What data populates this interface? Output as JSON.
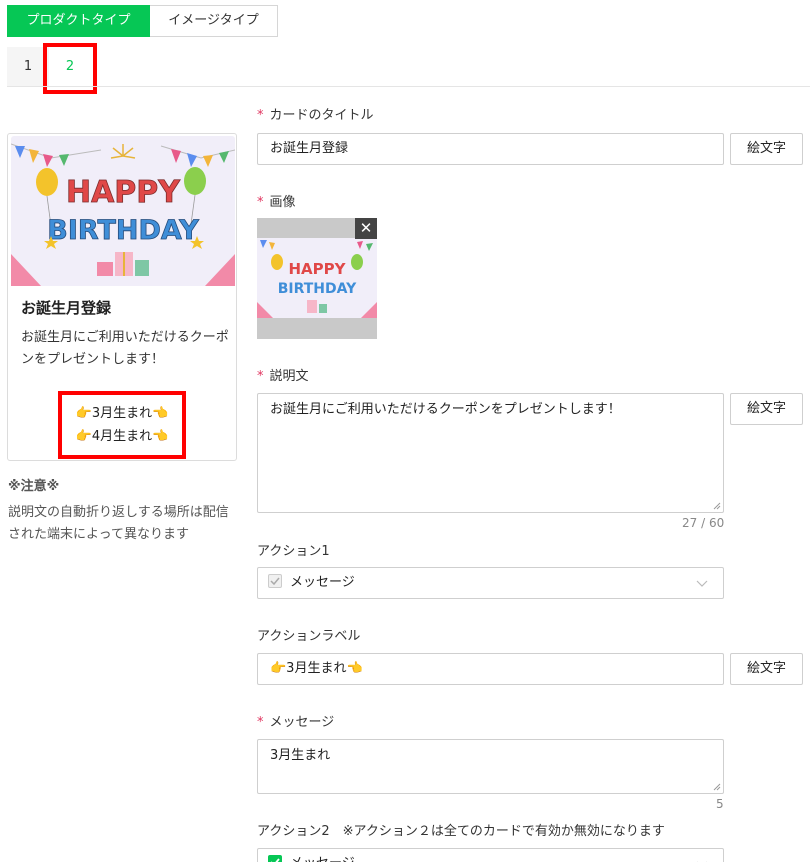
{
  "type_tabs": [
    "プロダクトタイプ",
    "イメージタイプ"
  ],
  "page_tabs": [
    "1",
    "2"
  ],
  "preview": {
    "title": "お誕生月登録",
    "description": "お誕生月にご利用いただけるクーポンをプレゼントします！",
    "actions": [
      "👉3月生まれ👈",
      "👉4月生まれ👈"
    ],
    "image_text": [
      "HAPPY",
      "BIRTHDAY"
    ]
  },
  "note": {
    "title": "※注意※",
    "body": "説明文の自動折り返しする場所は配信された端末によって異なります"
  },
  "form": {
    "card_title_label": "カードのタイトル",
    "card_title_value": "お誕生月登録",
    "emoji_button": "絵文字",
    "image_label": "画像",
    "close_symbol": "✕",
    "description_label": "説明文",
    "description_value": "お誕生月にご利用いただけるクーポンをプレゼントします！",
    "description_counter": "27 / 60",
    "action1_label": "アクション1",
    "action1_type": "メッセージ",
    "action_label_label": "アクションラベル",
    "action_label_value": "👉3月生まれ👈",
    "message_label": "メッセージ",
    "message_value": "3月生まれ",
    "message_counter": "5",
    "action2_label": "アクション2　※アクション２は全てのカードで有効か無効になります",
    "action2_type": "メッセージ"
  },
  "colors": {
    "accent": "#06c755",
    "highlight": "#ff0000",
    "required": "#e0335e"
  }
}
